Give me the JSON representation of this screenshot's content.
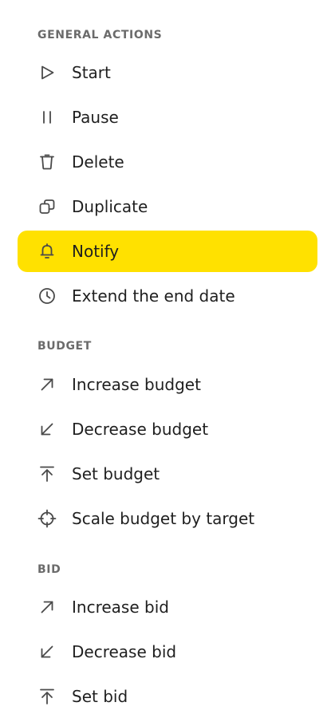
{
  "sections": [
    {
      "title": "GENERAL ACTIONS",
      "items": [
        {
          "label": "Start",
          "icon": "play-icon"
        },
        {
          "label": "Pause",
          "icon": "pause-icon"
        },
        {
          "label": "Delete",
          "icon": "trash-icon"
        },
        {
          "label": "Duplicate",
          "icon": "duplicate-icon"
        },
        {
          "label": "Notify",
          "icon": "bell-icon",
          "active": true
        },
        {
          "label": "Extend the end date",
          "icon": "clock-icon"
        }
      ]
    },
    {
      "title": "BUDGET",
      "items": [
        {
          "label": "Increase budget",
          "icon": "arrow-up-right-icon"
        },
        {
          "label": "Decrease budget",
          "icon": "arrow-down-left-icon"
        },
        {
          "label": "Set budget",
          "icon": "arrow-up-to-line-icon"
        },
        {
          "label": "Scale budget by target",
          "icon": "crosshair-icon"
        }
      ]
    },
    {
      "title": "BID",
      "items": [
        {
          "label": "Increase bid",
          "icon": "arrow-up-right-icon"
        },
        {
          "label": "Decrease bid",
          "icon": "arrow-down-left-icon"
        },
        {
          "label": "Set bid",
          "icon": "arrow-up-to-line-icon"
        }
      ]
    }
  ],
  "colors": {
    "active_background": "#ffe100",
    "section_header": "#6b6b6b",
    "icon": "#4a4a4a",
    "text": "#1f1f1f"
  }
}
